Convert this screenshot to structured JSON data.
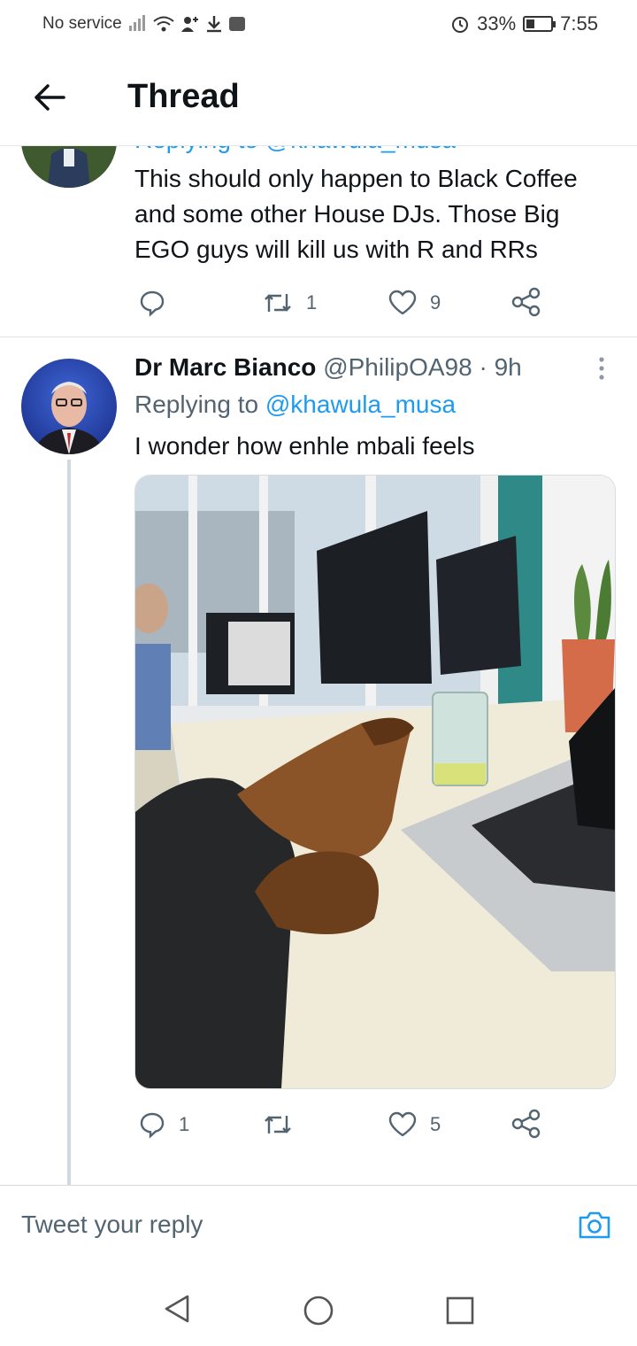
{
  "status_bar": {
    "carrier": "No service",
    "alarm_icon": "alarm-icon",
    "battery": "33%",
    "battery_level": 0.33,
    "time": "7:55"
  },
  "header": {
    "title": "Thread",
    "back_icon": "arrow-left-icon"
  },
  "tweets": [
    {
      "replying_partial": "Replying to @khawula_musa",
      "text": "This should only happen to Black Coffee and some other House DJs. Those Big EGO guys will kill us with R and RRs",
      "reply_count": "",
      "retweet_count": "1",
      "like_count": "9"
    },
    {
      "name": "Dr Marc Bianco",
      "handle": "@PhilipOA98",
      "time": "· 9h",
      "replying_label": "Replying to",
      "replying_user": "@khawula_musa",
      "text": "I wonder how enhle mbali feels",
      "reply_count": "1",
      "retweet_count": "",
      "like_count": "5"
    }
  ],
  "reply_bar": {
    "placeholder": "Tweet your reply",
    "camera_icon": "camera-icon"
  },
  "colors": {
    "accent": "#1d9bf0",
    "secondary_text": "#536471",
    "thread_line": "#cfd9de"
  }
}
